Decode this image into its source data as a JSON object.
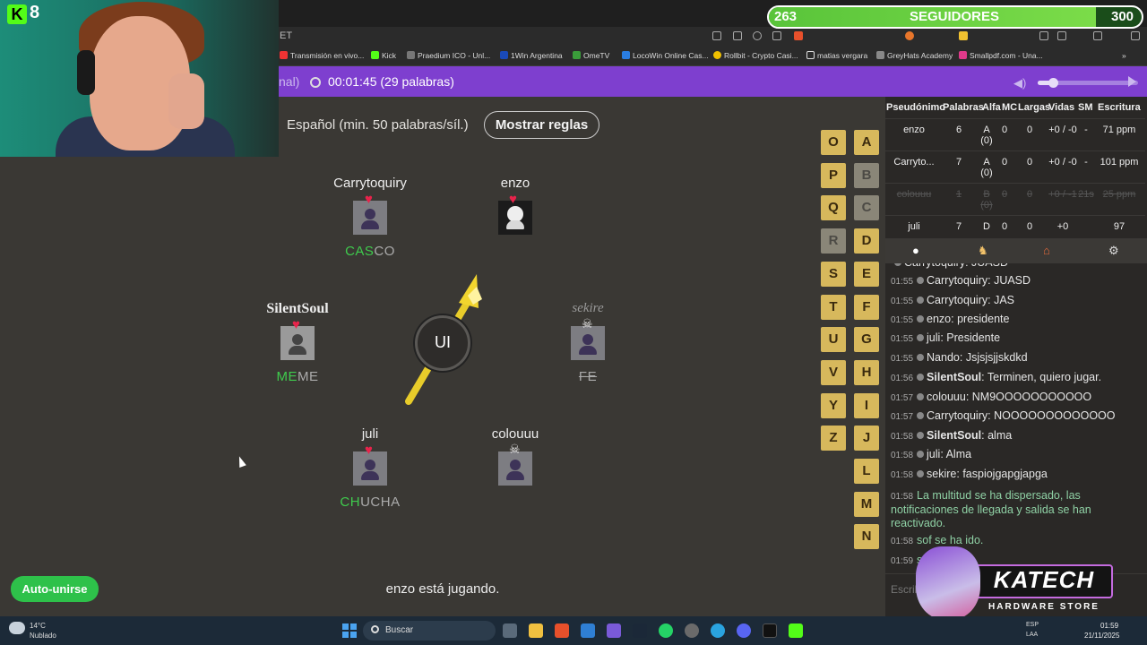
{
  "browser": {
    "url_fragment": "ET",
    "bookmarks": [
      "Transmisión en vivo...",
      "Kick",
      "Praedium ICO - Unl...",
      "1Win Argentina",
      "OmeTV",
      "LocoWin Online Cas...",
      "Rollbit - Crypto Casi...",
      "matias vergara",
      "GreyHats Academy",
      "Smallpdf.com - Una..."
    ]
  },
  "game": {
    "mode": "nal)",
    "timer": "00:01:45 (29 palabras)",
    "language": "Español (min. 50 palabras/síl.)",
    "rules_button": "Mostrar reglas",
    "bomb_syllable": "UI",
    "players": [
      {
        "name": "Carrytoquiry",
        "word_green": "CAS",
        "word_rest": "CO",
        "alive": true,
        "heart": true
      },
      {
        "name": "enzo",
        "word_green": "",
        "word_rest": "",
        "alive": true,
        "heart": true
      },
      {
        "name": "SilentSoul",
        "word_green": "ME",
        "word_rest": "ME",
        "alive": true,
        "heart": true
      },
      {
        "name": "sekire",
        "word_green": "",
        "word_rest": "FE",
        "alive": false,
        "heart": false
      },
      {
        "name": "juli",
        "word_green": "CH",
        "word_rest": "UCHA",
        "alive": true,
        "heart": true
      },
      {
        "name": "colouuu",
        "word_green": "",
        "word_rest": "",
        "alive": false,
        "heart": false
      }
    ],
    "letters_col1": [
      "O",
      "P",
      "Q",
      "R",
      "S",
      "T",
      "U",
      "V",
      "Y",
      "Z"
    ],
    "letters_col2": [
      "A",
      "B",
      "C",
      "D",
      "E",
      "F",
      "G",
      "H",
      "I",
      "J",
      "L",
      "M",
      "N"
    ],
    "used_letters": [
      "R",
      "B",
      "C"
    ],
    "auto_join": "Auto-unirse",
    "status": "enzo está jugando."
  },
  "scoreboard": {
    "headers": [
      "Pseudónimo",
      "Palabras",
      "Alfa",
      "MC",
      "Largas",
      "Vidas",
      "SM",
      "Escritura"
    ],
    "rows": [
      {
        "name": "enzo",
        "words": "6",
        "alfa": "A (0)",
        "mc": "0",
        "largas": "0",
        "vidas": "+0 / -0",
        "sm": "-",
        "escritura": "71 ppm",
        "dead": false
      },
      {
        "name": "Carryto...",
        "words": "7",
        "alfa": "A (0)",
        "mc": "0",
        "largas": "0",
        "vidas": "+0 / -0",
        "sm": "-",
        "escritura": "101 ppm",
        "dead": false
      },
      {
        "name": "colouuu",
        "words": "1",
        "alfa": "B (0)",
        "mc": "0",
        "largas": "0",
        "vidas": "+0 / -1",
        "sm": "21s",
        "escritura": "25 ppm",
        "dead": true
      },
      {
        "name": "juli",
        "words": "7",
        "alfa": "D",
        "mc": "0",
        "largas": "0",
        "vidas": "+0",
        "sm": "",
        "escritura": "97",
        "dead": false
      }
    ]
  },
  "chat": {
    "messages": [
      {
        "time": "",
        "user": "Carrytoquiry",
        "text": "JUASD",
        "bold": false,
        "sys": false
      },
      {
        "time": "01:55",
        "user": "Carrytoquiry",
        "text": "JUASD",
        "bold": false,
        "sys": false
      },
      {
        "time": "01:55",
        "user": "Carrytoquiry",
        "text": "JAS",
        "bold": false,
        "sys": false
      },
      {
        "time": "01:55",
        "user": "enzo",
        "text": "presidente",
        "bold": false,
        "sys": false
      },
      {
        "time": "01:55",
        "user": "juli",
        "text": "Presidente",
        "bold": false,
        "sys": false
      },
      {
        "time": "01:55",
        "user": "Nando",
        "text": "Jsjsjsjjskdkd",
        "bold": false,
        "sys": false
      },
      {
        "time": "01:56",
        "user": "SilentSoul",
        "text": "Terminen, quiero jugar.",
        "bold": true,
        "sys": false
      },
      {
        "time": "01:57",
        "user": "colouuu",
        "text": "NM9OOOOOOOOOOO",
        "bold": false,
        "sys": false
      },
      {
        "time": "01:57",
        "user": "Carrytoquiry",
        "text": "NOOOOOOOOOOOOO",
        "bold": false,
        "sys": false
      },
      {
        "time": "01:58",
        "user": "SilentSoul",
        "text": "alma",
        "bold": true,
        "sys": false
      },
      {
        "time": "01:58",
        "user": "juli",
        "text": "Alma",
        "bold": false,
        "sys": false
      },
      {
        "time": "01:58",
        "user": "sekire",
        "text": "faspiojgapgjapga",
        "bold": false,
        "sys": false
      },
      {
        "time": "01:58",
        "user": "",
        "text": "La multitud se ha dispersado, las notificaciones de llegada y salida se han reactivado.",
        "bold": false,
        "sys": true
      },
      {
        "time": "01:58",
        "user": "",
        "text": "sof se ha ido.",
        "bold": false,
        "sys": true
      },
      {
        "time": "01:59",
        "user": "",
        "text": "se ha ido.",
        "bold": false,
        "sys": true
      }
    ],
    "input_placeholder": "Escribe"
  },
  "stream": {
    "viewers": "8",
    "followers_count": "263",
    "followers_label": "SEGUIDORES",
    "followers_goal": "300",
    "followers_progress": 0.877,
    "sponsor_title": "KATECH",
    "sponsor_subtitle": "HARDWARE STORE"
  },
  "taskbar": {
    "temp": "14°C",
    "weather": "Nublado",
    "search": "Buscar",
    "lang1": "ESP",
    "lang2": "LAA",
    "time": "01:59",
    "date": "21/11/2025"
  },
  "colors": {
    "accent": "#7e3fcf",
    "letter": "#d7b85c",
    "green": "#3fcb4d",
    "follow": "#59c43a"
  }
}
